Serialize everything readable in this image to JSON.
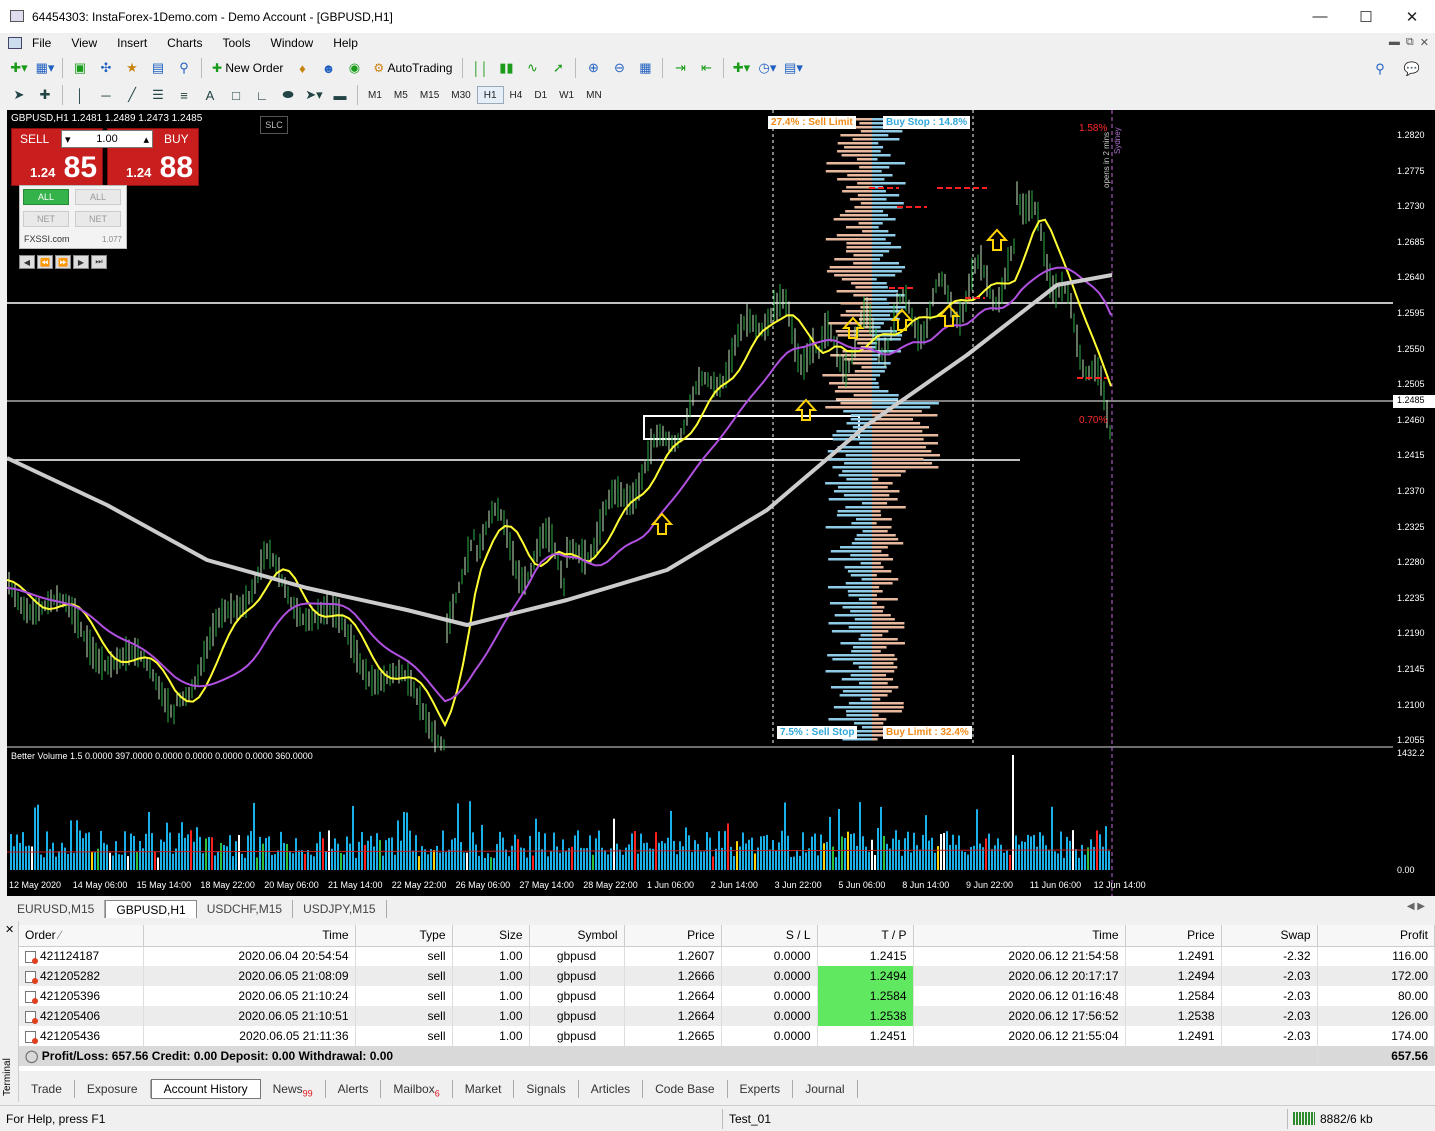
{
  "window": {
    "title": "64454303: InstaForex-1Demo.com - Demo Account - [GBPUSD,H1]"
  },
  "menu": [
    "File",
    "View",
    "Insert",
    "Charts",
    "Tools",
    "Window",
    "Help"
  ],
  "toolbar": {
    "new_order": "New Order",
    "autotrading": "AutoTrading"
  },
  "timeframes": [
    "M1",
    "M5",
    "M15",
    "M30",
    "H1",
    "H4",
    "D1",
    "W1",
    "MN"
  ],
  "active_timeframe": "H1",
  "chart": {
    "ohlc": "GBPUSD,H1  1.2481 1.2489 1.2473 1.2485",
    "slc": "SLC",
    "one_click": {
      "sell_label": "SELL",
      "buy_label": "BUY",
      "lot": "1.00",
      "sell_price_small": "1.24",
      "sell_price_big": "85",
      "buy_price_small": "1.24",
      "buy_price_big": "88"
    },
    "fxssi": {
      "all1": "ALL",
      "all2": "ALL",
      "net1": "NET",
      "net2": "NET",
      "site": "FXSSI.com",
      "version": "1.077"
    },
    "order_labels": {
      "sell_limit": "27.4% : Sell Limit",
      "buy_stop": "Buy Stop : 14.8%",
      "sell_stop": "7.5% : Sell Stop",
      "buy_limit": "Buy Limit : 32.4%"
    },
    "pct_top": "1.58%",
    "pct_bottom": "0.70%",
    "sydney": "opens in 2 mins",
    "sydney2": "Sydney",
    "volume_title": "Better Volume 1.5 0.0000 397.0000 0.0000 0.0000 0.0000 0.0000 360.0000",
    "volume_scale_top": "1432.2",
    "volume_scale_bottom": "0.00",
    "current_price": "1.2485",
    "price_levels": [
      "1.2820",
      "1.2775",
      "1.2730",
      "1.2685",
      "1.2640",
      "1.2595",
      "1.2550",
      "1.2505",
      "1.2460",
      "1.2415",
      "1.2370",
      "1.2325",
      "1.2280",
      "1.2235",
      "1.2190",
      "1.2145",
      "1.2100",
      "1.2055"
    ],
    "dates": [
      "12 May 2020",
      "14 May 06:00",
      "15 May 14:00",
      "18 May 22:00",
      "20 May 06:00",
      "21 May 14:00",
      "22 May 22:00",
      "26 May 06:00",
      "27 May 14:00",
      "28 May 22:00",
      "1 Jun 06:00",
      "2 Jun 14:00",
      "3 Jun 22:00",
      "5 Jun 06:00",
      "8 Jun 14:00",
      "9 Jun 22:00",
      "11 Jun 06:00",
      "12 Jun 14:00"
    ]
  },
  "chart_tabs": [
    "EURUSD,M15",
    "GBPUSD,H1",
    "USDCHF,M15",
    "USDJPY,M15"
  ],
  "active_chart_tab": "GBPUSD,H1",
  "terminal": {
    "columns": [
      "Order",
      "Time",
      "Type",
      "Size",
      "Symbol",
      "Price",
      "S / L",
      "T / P",
      "Time",
      "Price",
      "Swap",
      "Profit"
    ],
    "rows": [
      [
        "421124187",
        "2020.06.04 20:54:54",
        "sell",
        "1.00",
        "gbpusd",
        "1.2607",
        "0.0000",
        "1.2415",
        "2020.06.12 21:54:58",
        "1.2491",
        "-2.32",
        "116.00"
      ],
      [
        "421205282",
        "2020.06.05 21:08:09",
        "sell",
        "1.00",
        "gbpusd",
        "1.2666",
        "0.0000",
        "1.2494",
        "2020.06.12 20:17:17",
        "1.2494",
        "-2.03",
        "172.00"
      ],
      [
        "421205396",
        "2020.06.05 21:10:24",
        "sell",
        "1.00",
        "gbpusd",
        "1.2664",
        "0.0000",
        "1.2584",
        "2020.06.12 01:16:48",
        "1.2584",
        "-2.03",
        "80.00"
      ],
      [
        "421205406",
        "2020.06.05 21:10:51",
        "sell",
        "1.00",
        "gbpusd",
        "1.2664",
        "0.0000",
        "1.2538",
        "2020.06.12 17:56:52",
        "1.2538",
        "-2.03",
        "126.00"
      ],
      [
        "421205436",
        "2020.06.05 21:11:36",
        "sell",
        "1.00",
        "gbpusd",
        "1.2665",
        "0.0000",
        "1.2451",
        "2020.06.12 21:55:04",
        "1.2491",
        "-2.03",
        "174.00"
      ]
    ],
    "summary": "Profit/Loss: 657.56  Credit: 0.00  Deposit: 0.00  Withdrawal: 0.00",
    "summary_total": "657.56",
    "side_label": "Terminal"
  },
  "bottom_tabs": [
    {
      "label": "Trade",
      "badge": ""
    },
    {
      "label": "Exposure",
      "badge": ""
    },
    {
      "label": "Account History",
      "badge": ""
    },
    {
      "label": "News",
      "badge": "99"
    },
    {
      "label": "Alerts",
      "badge": ""
    },
    {
      "label": "Mailbox",
      "badge": "6"
    },
    {
      "label": "Market",
      "badge": ""
    },
    {
      "label": "Signals",
      "badge": ""
    },
    {
      "label": "Articles",
      "badge": ""
    },
    {
      "label": "Code Base",
      "badge": ""
    },
    {
      "label": "Experts",
      "badge": ""
    },
    {
      "label": "Journal",
      "badge": ""
    }
  ],
  "active_bottom_tab": "Account History",
  "status": {
    "help": "For Help, press F1",
    "profile": "Test_01",
    "traffic": "8882/6 kb"
  },
  "colors": {
    "chart_bg": "#000000",
    "sell": "#c81e1e",
    "tp_hit": "#60e860",
    "ma_fast": "#ffff33",
    "ma_mid": "#b050e0",
    "ma_slow": "#cccccc"
  }
}
